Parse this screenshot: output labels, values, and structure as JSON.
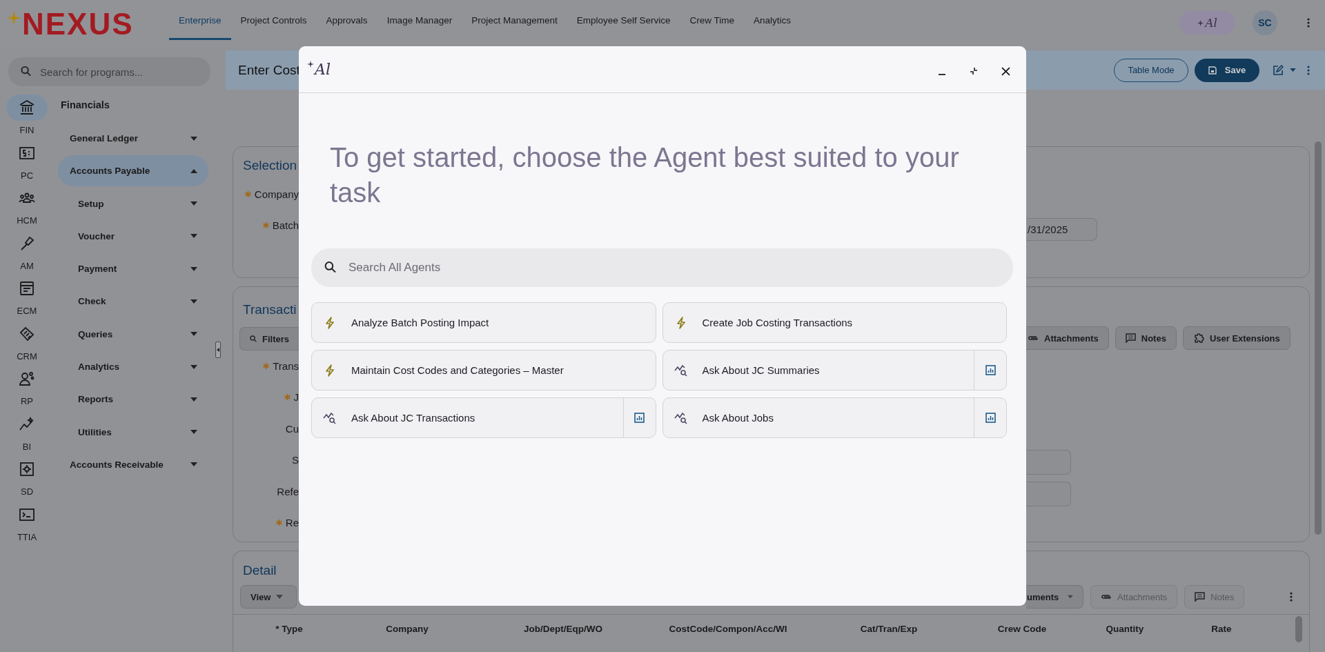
{
  "app": {
    "logo": "NEXUS"
  },
  "nav_tabs": [
    {
      "label": "Enterprise",
      "selected": true
    },
    {
      "label": "Project Controls",
      "selected": false
    },
    {
      "label": "Approvals",
      "selected": false
    },
    {
      "label": "Image Manager",
      "selected": false
    },
    {
      "label": "Project Management",
      "selected": false
    },
    {
      "label": "Employee Self Service",
      "selected": false
    },
    {
      "label": "Crew Time",
      "selected": false
    },
    {
      "label": "Analytics",
      "selected": false
    }
  ],
  "ai_button": {
    "label": "Al"
  },
  "avatar": {
    "initials": "SC"
  },
  "program_search": {
    "placeholder": "Search for programs..."
  },
  "modules": [
    {
      "label": "FIN",
      "selected": true
    },
    {
      "label": "PC",
      "selected": false
    },
    {
      "label": "HCM",
      "selected": false
    },
    {
      "label": "AM",
      "selected": false
    },
    {
      "label": "ECM",
      "selected": false
    },
    {
      "label": "CRM",
      "selected": false
    },
    {
      "label": "RP",
      "selected": false
    },
    {
      "label": "BI",
      "selected": false
    },
    {
      "label": "SD",
      "selected": false
    },
    {
      "label": "TTIA",
      "selected": false
    }
  ],
  "menu": {
    "title": "Financials",
    "items": [
      {
        "label": "General Ledger",
        "expanded": false,
        "selected": false
      },
      {
        "label": "Accounts Payable",
        "expanded": true,
        "selected": true,
        "children": [
          {
            "label": "Setup",
            "expanded": false,
            "selected": false
          },
          {
            "label": "Voucher",
            "expanded": false,
            "selected": false
          },
          {
            "label": "Payment",
            "expanded": false,
            "selected": false
          },
          {
            "label": "Check",
            "expanded": false,
            "selected": false
          },
          {
            "label": "Queries",
            "expanded": false,
            "selected": false
          },
          {
            "label": "Analytics",
            "expanded": false,
            "selected": false
          },
          {
            "label": "Reports",
            "expanded": false,
            "selected": false
          },
          {
            "label": "Utilities",
            "expanded": false,
            "selected": false
          }
        ]
      },
      {
        "label": "Accounts Receivable",
        "expanded": false,
        "selected": false
      }
    ]
  },
  "page": {
    "title": "Enter Cost",
    "buttons": [
      "Table Mode",
      "Save"
    ]
  },
  "selection": {
    "title": "Selection",
    "fields": [
      {
        "label": "Company",
        "required": true
      },
      {
        "label": "Batch",
        "required": true
      }
    ],
    "date_value": "/31/2025"
  },
  "transaction": {
    "title": "Transacti",
    "filter_button": "Filters",
    "buttons": [
      {
        "label": "Attachments",
        "kind": "attachments"
      },
      {
        "label": "Notes",
        "kind": "notes"
      },
      {
        "label": "User Extensions",
        "kind": "extensions"
      }
    ],
    "fields": [
      {
        "label": "Trans",
        "required": true
      },
      {
        "label": "J",
        "required": true
      },
      {
        "label": "Cu",
        "required": false
      },
      {
        "label": "S",
        "required": false
      },
      {
        "label": "Refe",
        "required": false
      },
      {
        "label": "Re",
        "required": true
      }
    ]
  },
  "detail": {
    "title": "Detail",
    "view_menu": "View",
    "toolbar": [
      {
        "label": "uments",
        "kind": "dropdown",
        "disabled": false
      },
      {
        "label": "Attachments",
        "kind": "attachments",
        "disabled": true
      },
      {
        "label": "Notes",
        "kind": "notes",
        "disabled": true
      }
    ],
    "columns": [
      "* Type",
      "Company",
      "Job/Dept/Eqp/WO",
      "CostCode/Compon/Acc/WI",
      "Cat/Tran/Exp",
      "Crew Code",
      "Quantity",
      "Rate"
    ]
  },
  "modal": {
    "title": "Al",
    "heading": "To get started, choose the Agent best suited to your task",
    "search": {
      "placeholder": "Search All Agents"
    },
    "agents": [
      {
        "name": "Analyze Batch Posting Impact",
        "kind": "action"
      },
      {
        "name": "Create Job Costing Transactions",
        "kind": "action"
      },
      {
        "name": "Maintain Cost Codes and Categories – Master",
        "kind": "action"
      },
      {
        "name": "Ask About JC Summaries",
        "kind": "query"
      },
      {
        "name": "Ask About JC Transactions",
        "kind": "query"
      },
      {
        "name": "Ask About Jobs",
        "kind": "query"
      }
    ]
  }
}
